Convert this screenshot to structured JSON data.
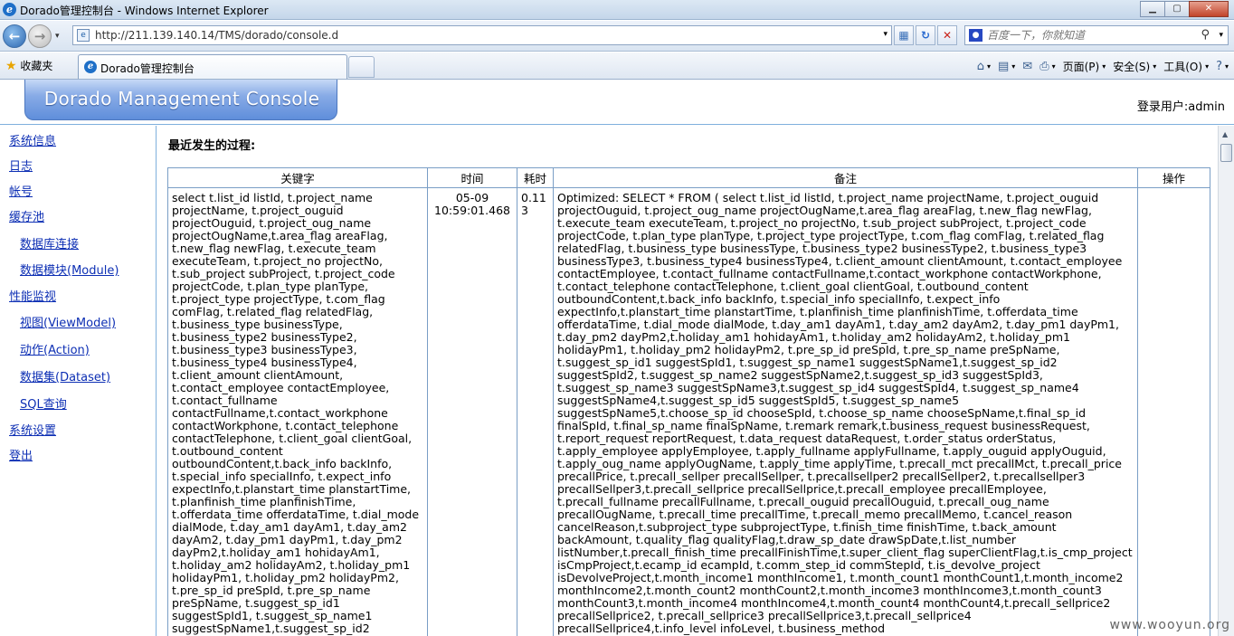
{
  "window": {
    "title": "Dorado管理控制台 - Windows Internet Explorer",
    "minimize": "▁",
    "maximize": "▢",
    "close": "✕"
  },
  "address_bar": {
    "url": "http://211.139.140.14/TMS/dorado/console.d"
  },
  "search": {
    "placeholder": "百度一下，你就知道"
  },
  "favorites": {
    "label": "收藏夹"
  },
  "tab": {
    "title": "Dorado管理控制台"
  },
  "command_bar": {
    "page": "页面(P)",
    "safety": "安全(S)",
    "tools": "工具(O)"
  },
  "icons": {
    "ie": "e",
    "back": "←",
    "forward": "→",
    "home": "⌂",
    "rss": "▤",
    "mail": "✉",
    "print": "⎙",
    "help": "?",
    "search": "⚲",
    "star": "★",
    "dropdown": "▾"
  },
  "app": {
    "banner": "Dorado Management Console",
    "login_user": "登录用户:admin"
  },
  "sidebar": {
    "items": [
      {
        "label": "系统信息"
      },
      {
        "label": "日志"
      },
      {
        "label": "帐号"
      },
      {
        "label": "缓存池"
      },
      {
        "label": "数据库连接"
      },
      {
        "label": "数据模块(Module)"
      },
      {
        "label": "性能监视"
      },
      {
        "label": "视图(ViewModel)"
      },
      {
        "label": "动作(Action)"
      },
      {
        "label": "数据集(Dataset)"
      },
      {
        "label": "SQL查询"
      },
      {
        "label": "系统设置"
      },
      {
        "label": "登出"
      }
    ]
  },
  "main": {
    "heading": "最近发生的过程:",
    "table": {
      "columns": [
        "关键字",
        "时间",
        "耗时",
        "备注",
        "操作"
      ],
      "rows": [
        {
          "keyword": "select t.list_id listId, t.project_name projectName, t.project_ouguid projectOuguid, t.project_oug_name projectOugName,t.area_flag areaFlag, t.new_flag newFlag, t.execute_team executeTeam, t.project_no projectNo, t.sub_project subProject, t.project_code projectCode, t.plan_type planType, t.project_type projectType, t.com_flag comFlag, t.related_flag relatedFlag, t.business_type businessType, t.business_type2 businessType2, t.business_type3 businessType3, t.business_type4 businessType4, t.client_amount clientAmount, t.contact_employee contactEmployee, t.contact_fullname contactFullname,t.contact_workphone contactWorkphone, t.contact_telephone contactTelephone, t.client_goal clientGoal, t.outbound_content outboundContent,t.back_info backInfo, t.special_info specialInfo, t.expect_info expectInfo,t.planstart_time planstartTime, t.planfinish_time planfinishTime, t.offerdata_time offerdataTime, t.dial_mode dialMode, t.day_am1 dayAm1, t.day_am2 dayAm2, t.day_pm1 dayPm1, t.day_pm2 dayPm2,t.holiday_am1 hohidayAm1, t.holiday_am2 holidayAm2, t.holiday_pm1 holidayPm1, t.holiday_pm2 holidayPm2, t.pre_sp_id preSpId, t.pre_sp_name preSpName, t.suggest_sp_id1 suggestSpId1, t.suggest_sp_name1 suggestSpName1,t.suggest_sp_id2",
          "time": "05-09\n10:59:01.468",
          "cost": "0.113",
          "remark": "Optimized: SELECT * FROM ( select t.list_id listId, t.project_name projectName, t.project_ouguid projectOuguid, t.project_oug_name projectOugName,t.area_flag areaFlag, t.new_flag newFlag, t.execute_team executeTeam, t.project_no projectNo, t.sub_project subProject, t.project_code projectCode, t.plan_type planType, t.project_type projectType, t.com_flag comFlag, t.related_flag relatedFlag, t.business_type businessType, t.business_type2 businessType2, t.business_type3 businessType3, t.business_type4 businessType4, t.client_amount clientAmount, t.contact_employee contactEmployee, t.contact_fullname contactFullname,t.contact_workphone contactWorkphone, t.contact_telephone contactTelephone, t.client_goal clientGoal, t.outbound_content outboundContent,t.back_info backInfo, t.special_info specialInfo, t.expect_info expectInfo,t.planstart_time planstartTime, t.planfinish_time planfinishTime, t.offerdata_time offerdataTime, t.dial_mode dialMode, t.day_am1 dayAm1, t.day_am2 dayAm2, t.day_pm1 dayPm1, t.day_pm2 dayPm2,t.holiday_am1 hohidayAm1, t.holiday_am2 holidayAm2, t.holiday_pm1 holidayPm1, t.holiday_pm2 holidayPm2, t.pre_sp_id preSpId, t.pre_sp_name preSpName, t.suggest_sp_id1 suggestSpId1, t.suggest_sp_name1 suggestSpName1,t.suggest_sp_id2 suggestSpId2, t.suggest_sp_name2 suggestSpName2,t.suggest_sp_id3 suggestSpId3, t.suggest_sp_name3 suggestSpName3,t.suggest_sp_id4 suggestSpId4, t.suggest_sp_name4 suggestSpName4,t.suggest_sp_id5 suggestSpId5, t.suggest_sp_name5 suggestSpName5,t.choose_sp_id chooseSpId, t.choose_sp_name chooseSpName,t.final_sp_id finalSpId, t.final_sp_name finalSpName, t.remark remark,t.business_request businessRequest, t.report_request reportRequest, t.data_request dataRequest, t.order_status orderStatus, t.apply_employee applyEmployee, t.apply_fullname applyFullname, t.apply_ouguid applyOuguid, t.apply_oug_name applyOugName, t.apply_time applyTime, t.precall_mct precallMct, t.precall_price precallPrice, t.precall_sellper precallSellper, t.precallsellper2 precallSellper2, t.precallsellper3 precallSellper3,t.precall_sellprice precallSellprice,t.precall_employee precallEmployee, t.precall_fullname precallFullname, t.precall_ouguid precallOuguid, t.precall_oug_name precallOugName, t.precall_time precallTime, t.precall_memo precallMemo, t.cancel_reason cancelReason,t.subproject_type subprojectType, t.finish_time finishTime, t.back_amount backAmount, t.quality_flag qualityFlag,t.draw_sp_date drawSpDate,t.list_number listNumber,t.precall_finish_time precallFinishTime,t.super_client_flag superClientFlag,t.is_cmp_project isCmpProject,t.ecamp_id ecampId, t.comm_step_id commStepId, t.is_devolve_project isDevolveProject,t.month_income1 monthIncome1, t.month_count1 monthCount1,t.month_income2 monthIncome2,t.month_count2 monthCount2,t.month_income3 monthIncome3,t.month_count3 monthCount3,t.month_income4 monthIncome4,t.month_count4 monthCount4,t.precall_sellprice2 precallSellprice2, t.precall_sellprice3 precallSellprice3,t.precall_sellprice4 precallSellprice4,t.info_level infoLevel, t.business_method",
          "action": ""
        }
      ]
    }
  },
  "watermark": "www.wooyun.org"
}
